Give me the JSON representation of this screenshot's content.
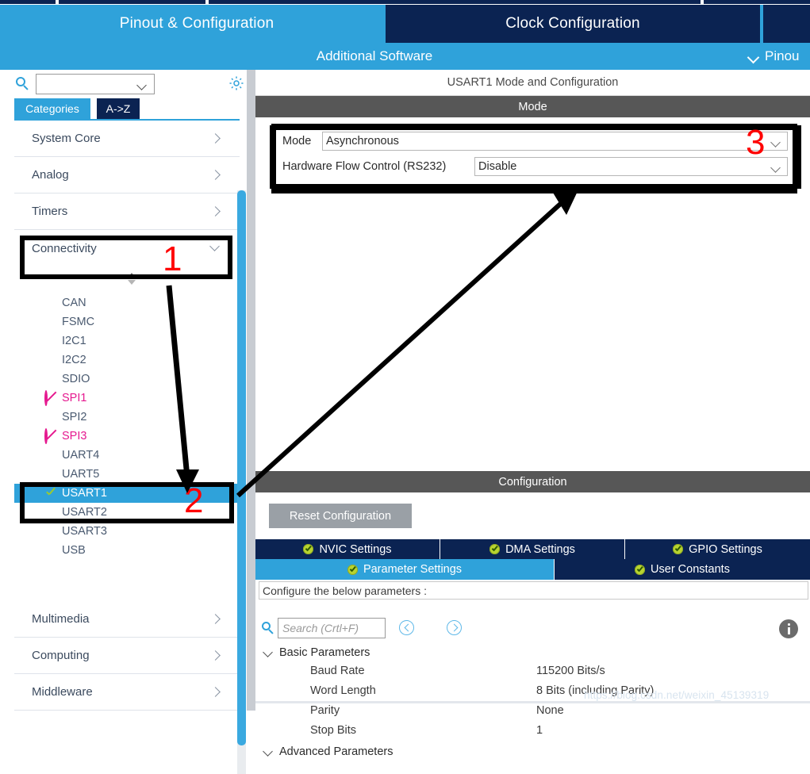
{
  "app": {
    "tabs": [
      {
        "label": "Pinout & Configuration",
        "active": true
      },
      {
        "label": "Clock Configuration",
        "active": false
      },
      {
        "label": "",
        "active": false
      }
    ],
    "secondary": {
      "additional_software": "Additional Software",
      "pinout_menu": "Pinou"
    }
  },
  "sidebar": {
    "search": {
      "value": "",
      "placeholder": ""
    },
    "gear_tooltip": "settings",
    "view_tabs": [
      {
        "label": "Categories",
        "selected": true
      },
      {
        "label": "A->Z",
        "selected": false
      }
    ],
    "categories": [
      {
        "label": "System Core",
        "expanded": false
      },
      {
        "label": "Analog",
        "expanded": false
      },
      {
        "label": "Timers",
        "expanded": false
      },
      {
        "label": "Connectivity",
        "expanded": true
      },
      {
        "label": "Multimedia",
        "expanded": false
      },
      {
        "label": "Computing",
        "expanded": false
      },
      {
        "label": "Middleware",
        "expanded": false
      }
    ],
    "connectivity_items": [
      {
        "label": "CAN",
        "state": "normal"
      },
      {
        "label": "FSMC",
        "state": "normal"
      },
      {
        "label": "I2C1",
        "state": "normal"
      },
      {
        "label": "I2C2",
        "state": "normal"
      },
      {
        "label": "SDIO",
        "state": "normal"
      },
      {
        "label": "SPI1",
        "state": "blocked"
      },
      {
        "label": "SPI2",
        "state": "normal"
      },
      {
        "label": "SPI3",
        "state": "blocked"
      },
      {
        "label": "UART4",
        "state": "normal"
      },
      {
        "label": "UART5",
        "state": "normal"
      },
      {
        "label": "USART1",
        "state": "selected"
      },
      {
        "label": "USART2",
        "state": "normal"
      },
      {
        "label": "USART3",
        "state": "normal"
      },
      {
        "label": "USB",
        "state": "normal"
      }
    ]
  },
  "right": {
    "header": "USART1 Mode and Configuration",
    "mode_band": "Mode",
    "config_band": "Configuration",
    "mode_fields": [
      {
        "label": "Mode",
        "value": "Asynchronous"
      },
      {
        "label": "Hardware Flow Control (RS232)",
        "value": "Disable"
      }
    ],
    "reset_button": "Reset Configuration",
    "settings_tabs_row1": [
      {
        "label": "NVIC Settings",
        "active": false
      },
      {
        "label": "DMA Settings",
        "active": false
      },
      {
        "label": "GPIO Settings",
        "active": false
      }
    ],
    "settings_tabs_row2": [
      {
        "label": "Parameter Settings",
        "active": true
      },
      {
        "label": "User Constants",
        "active": false
      }
    ],
    "configure_note": "Configure the below parameters :",
    "param_search": {
      "value": "",
      "placeholder": "Search (Crtl+F)"
    },
    "parameters": {
      "basic_group": "Basic Parameters",
      "advanced_group": "Advanced Parameters",
      "rows": [
        {
          "name": "Baud Rate",
          "value": "115200 Bits/s"
        },
        {
          "name": "Word Length",
          "value": "8 Bits (including Parity)"
        },
        {
          "name": "Parity",
          "value": "None"
        },
        {
          "name": "Stop Bits",
          "value": "1"
        }
      ]
    }
  },
  "annotations": {
    "step1": "1",
    "step2": "2",
    "step3": "3",
    "color": "#ff0000"
  },
  "watermark": "https://blog.csdn.net/weixin_45139319"
}
